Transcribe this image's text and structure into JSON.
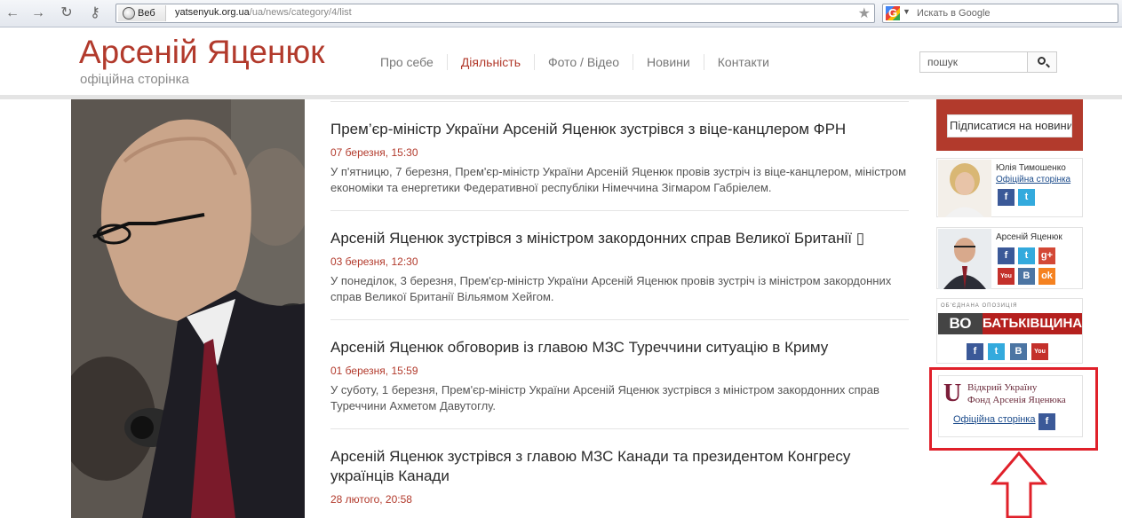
{
  "browser": {
    "search_badge": "Веб",
    "url_host": "yatsenyuk.org.ua",
    "url_path": "/ua/news/category/4/list",
    "google_placeholder": "Искать в Google",
    "google_logo": "G"
  },
  "site": {
    "title": "Арсеній Яценюк",
    "subtitle": "офіційна сторінка",
    "nav": [
      "Про себе",
      "Діяльність",
      "Фото / Відео",
      "Новини",
      "Контакти"
    ],
    "active_nav": "Діяльність",
    "search_placeholder": "пошук",
    "accent_color": "#b23a2c"
  },
  "news": [
    {
      "title": "Прем’єр-міністр України Арсеній Яценюк зустрівся з віце-канцлером ФРН",
      "date": "07 березня, 15:30",
      "text": "У п'ятницю, 7 березня, Прем'єр-міністр України Арсеній Яценюк провів зустріч із віце-канцлером, міністром економіки та енергетики Федеративної республіки Німеччина Зігмаром Габріелем."
    },
    {
      "title": "Арсеній Яценюк зустрівся з міністром закордонних справ Великої Британії ▯",
      "date": "03 березня, 12:30",
      "text": "У понеділок, 3 березня, Прем'єр-міністр України Арсеній Яценюк провів зустріч із міністром закордонних справ Великої Британії Вільямом Хейгом."
    },
    {
      "title": "Арсеній Яценюк обговорив із главою МЗС Туреччини ситуацію в Криму",
      "date": "01 березня, 15:59",
      "text": "У суботу, 1 березня, Прем'єр-міністр України Арсеній Яценюк зустрівся з міністром закордонних справ Туреччини Ахметом Давутоглу."
    },
    {
      "title": "Арсеній Яценюк зустрівся з главою МЗС Канади та президентом Конгресу українців Канади",
      "date": "28 лютого, 20:58",
      "text": ""
    }
  ],
  "sidebar": {
    "subscribe_label": "Підписатися на новини",
    "card1": {
      "name": "Юлія Тимошенко",
      "link": "Офіційна сторінка",
      "icons": [
        "f",
        "t"
      ]
    },
    "card2": {
      "name": "Арсеній Яценюк",
      "icons": [
        "f",
        "t",
        "g+",
        "You Tube",
        "B",
        "ok"
      ]
    },
    "party": {
      "top": "ОБ'ЄДНАНА ОПОЗИЦІЯ",
      "vo": "ВО",
      "bat": "БАТЬКІВЩИНА",
      "icons": [
        "f",
        "t",
        "B",
        "You Tube"
      ]
    },
    "fund": {
      "letter": "U",
      "line1": "Відкрий Україну",
      "line2": "Фонд Арсенія Яценюка",
      "link": "Офіційна сторінка",
      "icon": "f"
    }
  },
  "annotation": {
    "box_color": "#e0202a"
  }
}
